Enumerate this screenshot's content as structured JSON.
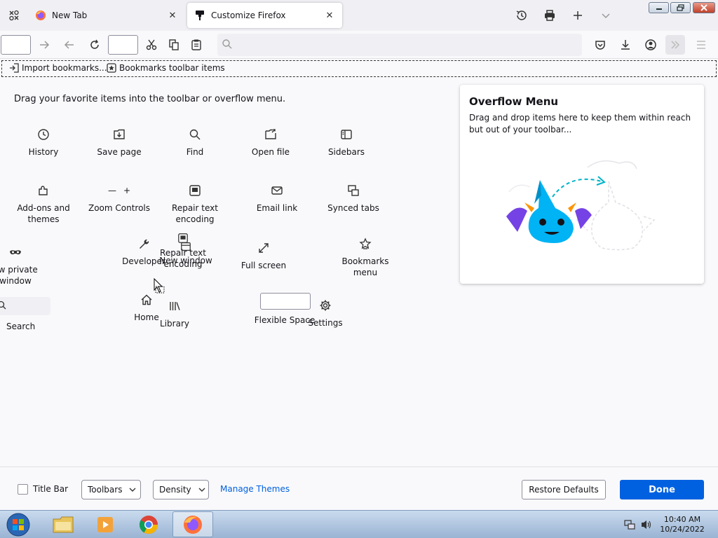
{
  "tabs": [
    {
      "label": "New Tab",
      "close": "✕"
    },
    {
      "label": "Customize Firefox",
      "close": "✕"
    }
  ],
  "bookmarks": {
    "import_label": "Import bookmarks...",
    "toolbar_items_label": "Bookmarks toolbar items"
  },
  "palette": {
    "title": "Drag your favorite items into the toolbar or overflow menu.",
    "items": {
      "history": "History",
      "save_page": "Save page",
      "find": "Find",
      "open_file": "Open file",
      "sidebars": "Sidebars",
      "addons": "Add-ons and themes",
      "zoom": "Zoom Controls",
      "zoom_minus": "—",
      "zoom_plus": "+",
      "repair_encoding": "Repair text encoding",
      "email_link": "Email link",
      "synced_tabs": "Synced tabs",
      "private_window": "ew private window",
      "developer": "Developer",
      "repair_encoding_drag": "Repair text encoding",
      "new_window": "New window",
      "full_screen": "Full screen",
      "bookmarks_menu": "Bookmarks menu",
      "search": "Search",
      "home": "Home",
      "library": "Library",
      "flexible_space": "Flexible Space",
      "settings": "Settings"
    }
  },
  "overflow": {
    "title": "Overflow Menu",
    "description": "Drag and drop items here to keep them within reach but out of your toolbar..."
  },
  "footer": {
    "title_bar_label": "Title Bar",
    "title_bar_checked": false,
    "toolbars_label": "Toolbars",
    "density_label": "Density",
    "manage_themes": "Manage Themes",
    "restore_defaults": "Restore Defaults",
    "done": "Done"
  },
  "taskbar": {
    "time": "10:40 AM",
    "date": "10/24/2022"
  },
  "colors": {
    "accent": "#0061e0",
    "link": "#0060df",
    "tabstrip": "#f0f0f4",
    "page": "#f9f9fb"
  }
}
